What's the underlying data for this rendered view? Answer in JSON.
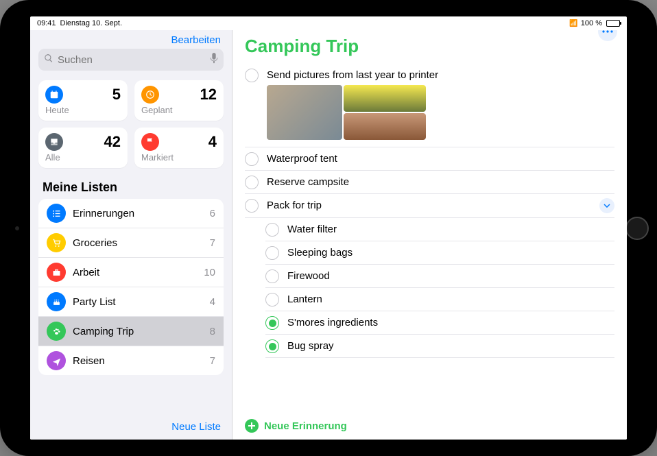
{
  "status": {
    "time": "09:41",
    "date": "Dienstag 10. Sept.",
    "battery_pct": "100 %"
  },
  "sidebar": {
    "edit_label": "Bearbeiten",
    "search_placeholder": "Suchen",
    "smart": [
      {
        "label": "Heute",
        "count": "5",
        "color": "#007aff",
        "icon": "calendar"
      },
      {
        "label": "Geplant",
        "count": "12",
        "color": "#ff9500",
        "icon": "clock"
      },
      {
        "label": "Alle",
        "count": "42",
        "color": "#5b6670",
        "icon": "inbox"
      },
      {
        "label": "Markiert",
        "count": "4",
        "color": "#ff3b30",
        "icon": "flag"
      }
    ],
    "lists_header": "Meine Listen",
    "lists": [
      {
        "name": "Erinnerungen",
        "count": "6",
        "color": "#007aff",
        "icon": "list",
        "selected": false
      },
      {
        "name": "Groceries",
        "count": "7",
        "color": "#ffcc00",
        "icon": "cart",
        "selected": false
      },
      {
        "name": "Arbeit",
        "count": "10",
        "color": "#ff3b30",
        "icon": "briefcase",
        "selected": false
      },
      {
        "name": "Party List",
        "count": "4",
        "color": "#007aff",
        "icon": "cake",
        "selected": false
      },
      {
        "name": "Camping Trip",
        "count": "8",
        "color": "#34c759",
        "icon": "paw",
        "selected": true
      },
      {
        "name": "Reisen",
        "count": "7",
        "color": "#af52de",
        "icon": "plane",
        "selected": false
      }
    ],
    "new_list_label": "Neue Liste"
  },
  "main": {
    "title": "Camping Trip",
    "accent": "#34c759",
    "reminders": [
      {
        "text": "Send pictures from last year to printer",
        "done": false,
        "has_images": true,
        "sub": false,
        "expandable": false
      },
      {
        "text": "Waterproof tent",
        "done": false,
        "sub": false,
        "expandable": false
      },
      {
        "text": "Reserve campsite",
        "done": false,
        "sub": false,
        "expandable": false
      },
      {
        "text": "Pack for trip",
        "done": false,
        "sub": false,
        "expandable": true
      },
      {
        "text": "Water filter",
        "done": false,
        "sub": true,
        "expandable": false
      },
      {
        "text": "Sleeping bags",
        "done": false,
        "sub": true,
        "expandable": false
      },
      {
        "text": "Firewood",
        "done": false,
        "sub": true,
        "expandable": false
      },
      {
        "text": "Lantern",
        "done": false,
        "sub": true,
        "expandable": false
      },
      {
        "text": "S'mores ingredients",
        "done": true,
        "sub": true,
        "expandable": false
      },
      {
        "text": "Bug spray",
        "done": true,
        "sub": true,
        "expandable": false
      }
    ],
    "new_reminder_label": "Neue Erinnerung"
  }
}
